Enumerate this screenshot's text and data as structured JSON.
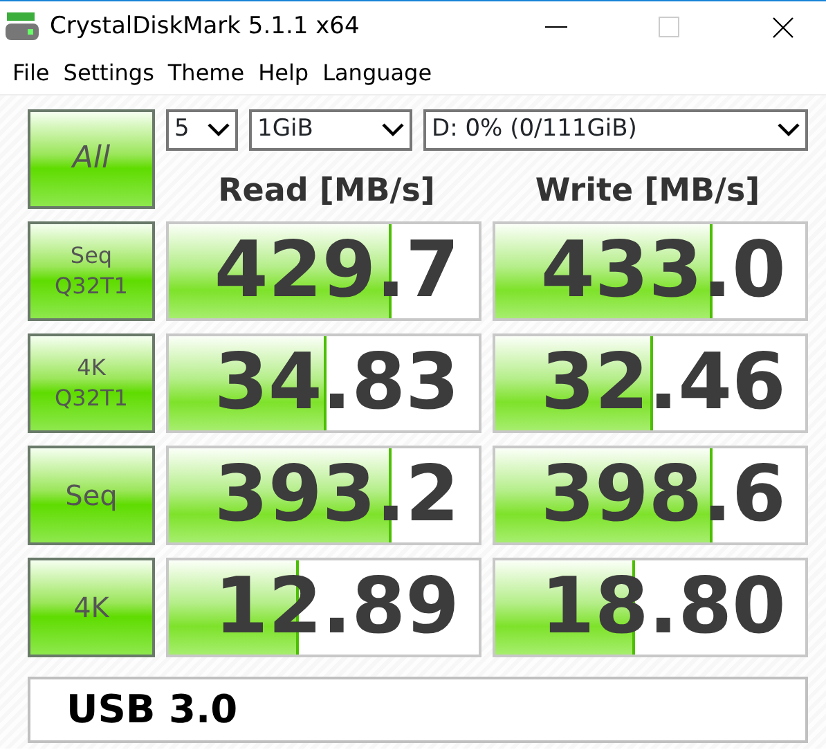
{
  "window": {
    "title": "CrystalDiskMark 5.1.1 x64"
  },
  "menu": [
    "File",
    "Settings",
    "Theme",
    "Help",
    "Language"
  ],
  "all_button": "All",
  "selects": [
    {
      "value": "5"
    },
    {
      "value": "1GiB"
    },
    {
      "value": "D: 0% (0/111GiB)"
    }
  ],
  "headers": [
    "Read [MB/s]",
    "Write [MB/s]"
  ],
  "rows": [
    {
      "label": "Seq\nQ32T1",
      "read": {
        "value": "429.7",
        "level": 0.72
      },
      "write": {
        "value": "433.0",
        "level": 0.7
      }
    },
    {
      "label": "4K\nQ32T1",
      "read": {
        "value": "34.83",
        "level": 0.51
      },
      "write": {
        "value": "32.46",
        "level": 0.51
      }
    },
    {
      "label": "Seq",
      "read": {
        "value": "393.2",
        "level": 0.72
      },
      "write": {
        "value": "398.6",
        "level": 0.7
      }
    },
    {
      "label": "4K",
      "read": {
        "value": "12.89",
        "level": 0.42
      },
      "write": {
        "value": "18.80",
        "level": 0.45
      }
    }
  ],
  "comment": "USB 3.0"
}
